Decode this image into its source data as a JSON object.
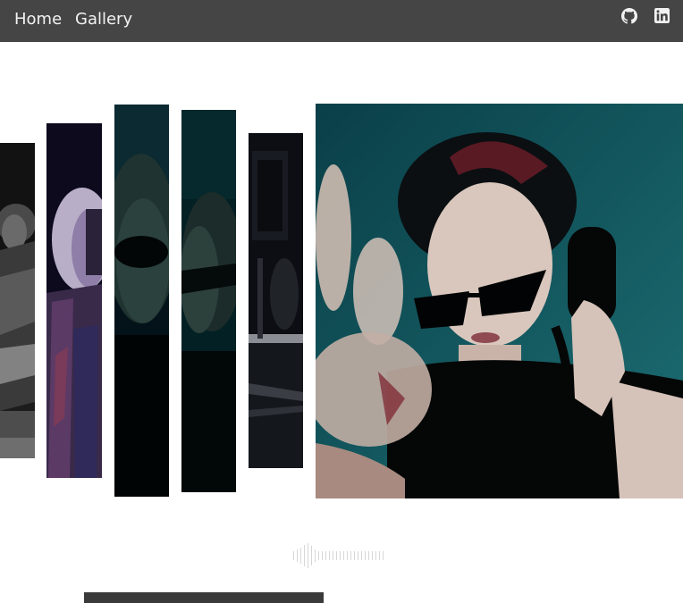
{
  "nav": {
    "home_label": "Home",
    "gallery_label": "Gallery",
    "icons": [
      "github-icon",
      "linkedin-icon"
    ]
  },
  "colors": {
    "topbar": "#454545",
    "nav_text": "#f2f2f2",
    "background": "#ffffff",
    "progress": "#3a3a3a",
    "waveform": "#d7d7d7"
  },
  "gallery": {
    "strips": [
      {
        "name": "gallery-strip-guitarist"
      },
      {
        "name": "gallery-strip-silver-wig"
      },
      {
        "name": "gallery-strip-sunglasses-portrait"
      },
      {
        "name": "gallery-strip-sunglasses-profile"
      },
      {
        "name": "gallery-strip-studio-gear"
      }
    ],
    "featured": {
      "name": "featured-photo-telephone"
    }
  }
}
